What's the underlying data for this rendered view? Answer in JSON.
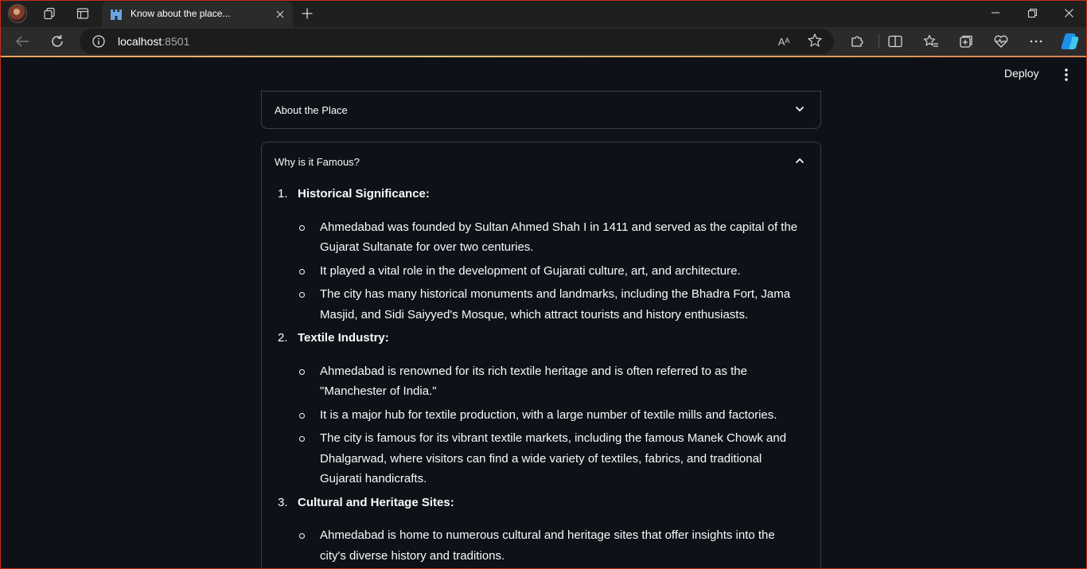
{
  "browser": {
    "tab_title": "Know about the place...",
    "url_host": "localhost",
    "url_port": ":8501",
    "read_aloud_glyph": "Aᴬ"
  },
  "header": {
    "deploy_label": "Deploy"
  },
  "expanders": [
    {
      "title": "About the Place",
      "expanded": false
    },
    {
      "title": "Why is it Famous?",
      "expanded": true
    }
  ],
  "famous": [
    {
      "number": "1.",
      "heading": "Historical Significance:",
      "bullets": [
        "Ahmedabad was founded by Sultan Ahmed Shah I in 1411 and served as the capital of the Gujarat Sultanate for over two centuries.",
        "It played a vital role in the development of Gujarati culture, art, and architecture.",
        "The city has many historical monuments and landmarks, including the Bhadra Fort, Jama Masjid, and Sidi Saiyyed's Mosque, which attract tourists and history enthusiasts."
      ]
    },
    {
      "number": "2.",
      "heading": "Textile Industry:",
      "bullets": [
        "Ahmedabad is renowned for its rich textile heritage and is often referred to as the \"Manchester of India.\"",
        "It is a major hub for textile production, with a large number of textile mills and factories.",
        "The city is famous for its vibrant textile markets, including the famous Manek Chowk and Dhalgarwad, where visitors can find a wide variety of textiles, fabrics, and traditional Gujarati handicrafts."
      ]
    },
    {
      "number": "3.",
      "heading": "Cultural and Heritage Sites:",
      "bullets": [
        "Ahmedabad is home to numerous cultural and heritage sites that offer insights into the city's diverse history and traditions."
      ]
    }
  ],
  "colors": {
    "page_bg": "#0e1117",
    "text": "#fafafa",
    "expander_border": "#3a3d45",
    "window_frame": "#c42b1c"
  }
}
